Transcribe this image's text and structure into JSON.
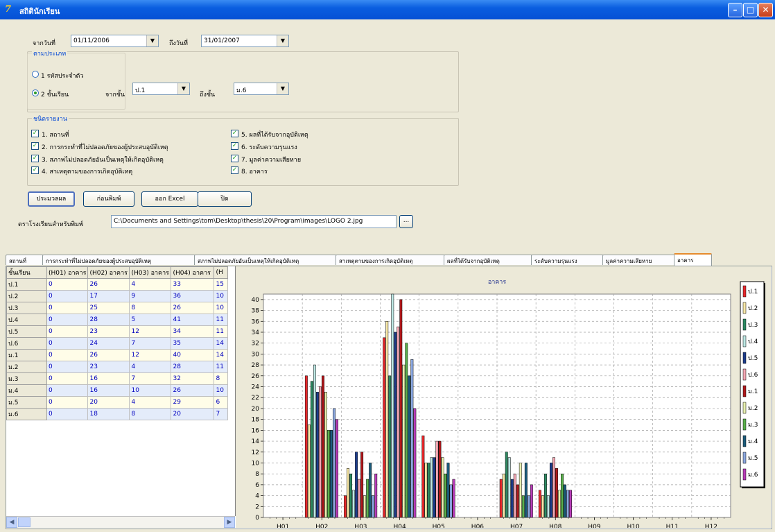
{
  "window": {
    "title": "สถิตินักเรียน",
    "icon": "app-logo-icon"
  },
  "filters": {
    "from_date_label": "จากวันที่",
    "from_date": "01/11/2006",
    "to_date_label": "ถึงวันที่",
    "to_date": "31/01/2007",
    "type_group_title": "ตามประเภท",
    "radio_1_label": "1 รหัสประจำตัว",
    "radio_2_label": "2 ชั้นเรียน",
    "selected_radio": 2,
    "from_class_label": "จากชั้น",
    "from_class": "ป.1",
    "to_class_label": "ถึงชั้น",
    "to_class": "ม.6"
  },
  "report": {
    "group_title": "ชนิดรายงาน",
    "checks": [
      {
        "label": "1. สถานที่",
        "checked": true
      },
      {
        "label": "2. การกระทำที่ไม่ปลอดภัยของผู้ประสบอุบัติเหตุ",
        "checked": true
      },
      {
        "label": "3. สภาพไม่ปลอดภัยอันเป็นเหตุให้เกิดอุบัติเหตุ",
        "checked": true
      },
      {
        "label": "4. สาเหตุตามของการเกิดอุบัติเหตุ",
        "checked": true
      },
      {
        "label": "5. ผลที่ได้รับจากอุบัติเหตุ",
        "checked": true
      },
      {
        "label": "6. ระดับความรุนแรง",
        "checked": true
      },
      {
        "label": "7. มูลค่าความเสียหาย",
        "checked": true
      },
      {
        "label": "8. อาคาร",
        "checked": true
      }
    ]
  },
  "buttons": {
    "process": "ประมวลผล",
    "preview": "ก่อนพิมพ์",
    "excel": "ออก Excel",
    "close": "ปิด"
  },
  "logo": {
    "label": "ตราโรงเรียนสำหรับพิมพ์",
    "path": "C:\\Documents and Settings\\tom\\Desktop\\thesis\\20\\Program\\images\\LOGO 2.jpg",
    "browse": "..."
  },
  "tabs": [
    {
      "label": "สถานที่",
      "active": false
    },
    {
      "label": "การกระทำที่ไม่ปลอดภัยของผู้ประสบอุบัติเหตุ",
      "active": false
    },
    {
      "label": "สภาพไม่ปลอดภัยอันเป็นเหตุให้เกิดอุบัติเหตุ",
      "active": false
    },
    {
      "label": "สาเหตุตามของการเกิดอุบัติเหตุ",
      "active": false
    },
    {
      "label": "ผลที่ได้รับจากอุบัติเหตุ",
      "active": false
    },
    {
      "label": "ระดับความรุนแรง",
      "active": false
    },
    {
      "label": "มูลค่าความเสียหาย",
      "active": false
    },
    {
      "label": "อาคาร",
      "active": true
    }
  ],
  "grid": {
    "columns": [
      "ชั้นเรียน",
      "(H01) อาคาร",
      "(H02) อาคาร",
      "(H03) อาคาร",
      "(H04) อาคาร",
      "(H"
    ],
    "rows": [
      [
        "ป.1",
        "0",
        "26",
        "4",
        "33",
        "15"
      ],
      [
        "ป.2",
        "0",
        "17",
        "9",
        "36",
        "10"
      ],
      [
        "ป.3",
        "0",
        "25",
        "8",
        "26",
        "10"
      ],
      [
        "ป.4",
        "0",
        "28",
        "5",
        "41",
        "11"
      ],
      [
        "ป.5",
        "0",
        "23",
        "12",
        "34",
        "11"
      ],
      [
        "ป.6",
        "0",
        "24",
        "7",
        "35",
        "14"
      ],
      [
        "ม.1",
        "0",
        "26",
        "12",
        "40",
        "14"
      ],
      [
        "ม.2",
        "0",
        "23",
        "4",
        "28",
        "11"
      ],
      [
        "ม.3",
        "0",
        "16",
        "7",
        "32",
        "8"
      ],
      [
        "ม.4",
        "0",
        "16",
        "10",
        "26",
        "10"
      ],
      [
        "ม.5",
        "0",
        "20",
        "4",
        "29",
        "6"
      ],
      [
        "ม.6",
        "0",
        "18",
        "8",
        "20",
        "7"
      ]
    ]
  },
  "chart_data": {
    "type": "bar",
    "title": "อาคาร",
    "categories": [
      "H01",
      "H02",
      "H03",
      "H04",
      "H05",
      "H06",
      "H07",
      "H08",
      "H09",
      "H10",
      "H11",
      "H12"
    ],
    "ylim": [
      0,
      41
    ],
    "yticks": [
      0,
      2,
      4,
      6,
      8,
      10,
      12,
      14,
      16,
      18,
      20,
      22,
      24,
      26,
      28,
      30,
      32,
      34,
      36,
      38,
      40
    ],
    "grid": true,
    "legend_position": "right",
    "series": [
      {
        "name": "ป.1",
        "color": "#e8282c",
        "values": [
          0,
          26,
          4,
          33,
          15,
          0,
          7,
          5,
          0,
          0,
          0,
          0
        ]
      },
      {
        "name": "ป.2",
        "color": "#f8e8a8",
        "values": [
          0,
          17,
          9,
          36,
          10,
          0,
          8,
          4,
          0,
          0,
          0,
          0
        ]
      },
      {
        "name": "ป.3",
        "color": "#2c8a62",
        "values": [
          0,
          25,
          8,
          26,
          10,
          0,
          12,
          8,
          0,
          0,
          0,
          0
        ]
      },
      {
        "name": "ป.4",
        "color": "#bde8e4",
        "values": [
          0,
          28,
          5,
          41,
          11,
          0,
          11,
          4,
          0,
          0,
          0,
          0
        ]
      },
      {
        "name": "ป.5",
        "color": "#1c3c8c",
        "values": [
          0,
          23,
          12,
          34,
          11,
          0,
          7,
          10,
          0,
          0,
          0,
          0
        ]
      },
      {
        "name": "ป.6",
        "color": "#f4a8b4",
        "values": [
          0,
          24,
          7,
          35,
          14,
          0,
          8,
          11,
          0,
          0,
          0,
          0
        ]
      },
      {
        "name": "ม.1",
        "color": "#b0181c",
        "values": [
          0,
          26,
          12,
          40,
          14,
          0,
          6,
          9,
          0,
          0,
          0,
          0
        ]
      },
      {
        "name": "ม.2",
        "color": "#e8f0b0",
        "values": [
          0,
          23,
          4,
          28,
          11,
          0,
          10,
          5,
          0,
          0,
          0,
          0
        ]
      },
      {
        "name": "ม.3",
        "color": "#5ab04c",
        "values": [
          0,
          16,
          7,
          32,
          8,
          0,
          4,
          8,
          0,
          0,
          0,
          0
        ]
      },
      {
        "name": "ม.4",
        "color": "#1c5c7c",
        "values": [
          0,
          16,
          10,
          26,
          10,
          0,
          10,
          6,
          0,
          0,
          0,
          0
        ]
      },
      {
        "name": "ม.5",
        "color": "#8ca8e0",
        "values": [
          0,
          20,
          4,
          29,
          6,
          0,
          4,
          5,
          0,
          0,
          0,
          0
        ]
      },
      {
        "name": "ม.6",
        "color": "#b83cb8",
        "values": [
          0,
          18,
          8,
          20,
          7,
          0,
          6,
          5,
          0,
          0,
          0,
          0
        ]
      }
    ]
  }
}
